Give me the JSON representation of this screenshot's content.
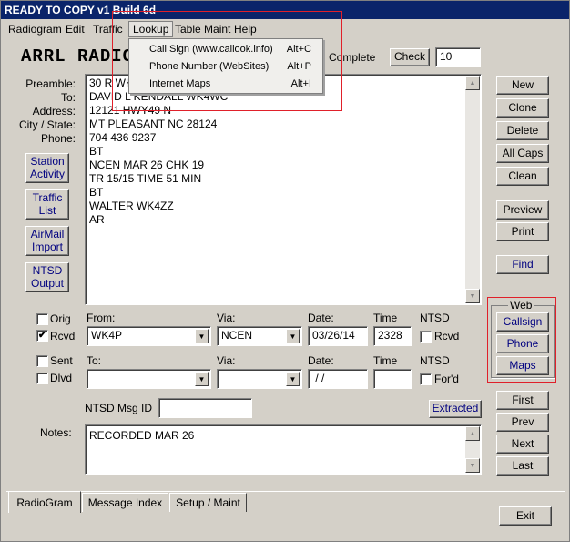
{
  "window": {
    "title": "READY TO COPY v1 Build 6d"
  },
  "menu": {
    "items": [
      "Radiogram",
      "Edit",
      "Traffic",
      "Lookup",
      "Table Maint",
      "Help"
    ],
    "lookup_dropdown": [
      {
        "label": "Call Sign (www.callook.info)",
        "shortcut": "Alt+C"
      },
      {
        "label": "Phone Number (WebSites)",
        "shortcut": "Alt+P"
      },
      {
        "label": "Internet Maps",
        "shortcut": "Alt+I"
      }
    ]
  },
  "header": {
    "title": "ARRL RADIO",
    "complete_label": "Complete",
    "check_button": "Check",
    "check_value": "10"
  },
  "message": {
    "field_labels": [
      "Preamble:",
      "To:",
      "Address:",
      "City / State:",
      "Phone:"
    ],
    "lines": [
      "30 R WK",
      "DAVID L KENDALL WK4WC",
      "12121 HWY49 N",
      "MT PLEASANT NC 28124",
      "704 436 9237",
      "BT",
      "NCEN MAR 26 CHK 19",
      "TR 15/15 TIME 51 MIN",
      "BT",
      "WALTER WK4ZZ",
      "AR"
    ]
  },
  "left_buttons": {
    "station_activity": "Station Activity",
    "traffic_list": "Traffic List",
    "airmail_import": "AirMail Import",
    "ntsd_output": "NTSD Output"
  },
  "right_buttons": {
    "new": "New",
    "clone": "Clone",
    "delete": "Delete",
    "all_caps": "All Caps",
    "clean": "Clean",
    "preview": "Preview",
    "print": "Print",
    "find": "Find"
  },
  "web_group": {
    "title": "Web",
    "callsign": "Callsign",
    "phone": "Phone",
    "maps": "Maps"
  },
  "nav_buttons": {
    "first": "First",
    "prev": "Prev",
    "next": "Next",
    "last": "Last",
    "exit": "Exit"
  },
  "routing": {
    "orig_label": "Orig",
    "rcvd_label": "Rcvd",
    "sent_label": "Sent",
    "dlvd_label": "Dlvd",
    "orig_checked": false,
    "rcvd_checked": true,
    "sent_checked": false,
    "dlvd_checked": false,
    "from_label": "From:",
    "to_label": "To:",
    "via_label": "Via:",
    "date_label": "Date:",
    "time_label": "Time",
    "ntsd_label": "NTSD",
    "ntsd_rcvd_label": "Rcvd",
    "ntsd_ford_label": "For'd",
    "from_value": "WK4P",
    "via1_value": "NCEN",
    "date1_value": "03/26/14",
    "time1_value": "2328",
    "to_value": "",
    "via2_value": "",
    "date2_value": " / /",
    "time2_value": ""
  },
  "ntsd_msg": {
    "label": "NTSD Msg ID",
    "value": "",
    "extracted_button": "Extracted"
  },
  "notes": {
    "label": "Notes:",
    "value": "RECORDED MAR 26"
  },
  "tabs": [
    "RadioGram",
    "Message Index",
    "Setup / Maint"
  ],
  "colors": {
    "titlebar": "#0a246a",
    "highlight": "#e0202a",
    "link_text": "#000080"
  }
}
